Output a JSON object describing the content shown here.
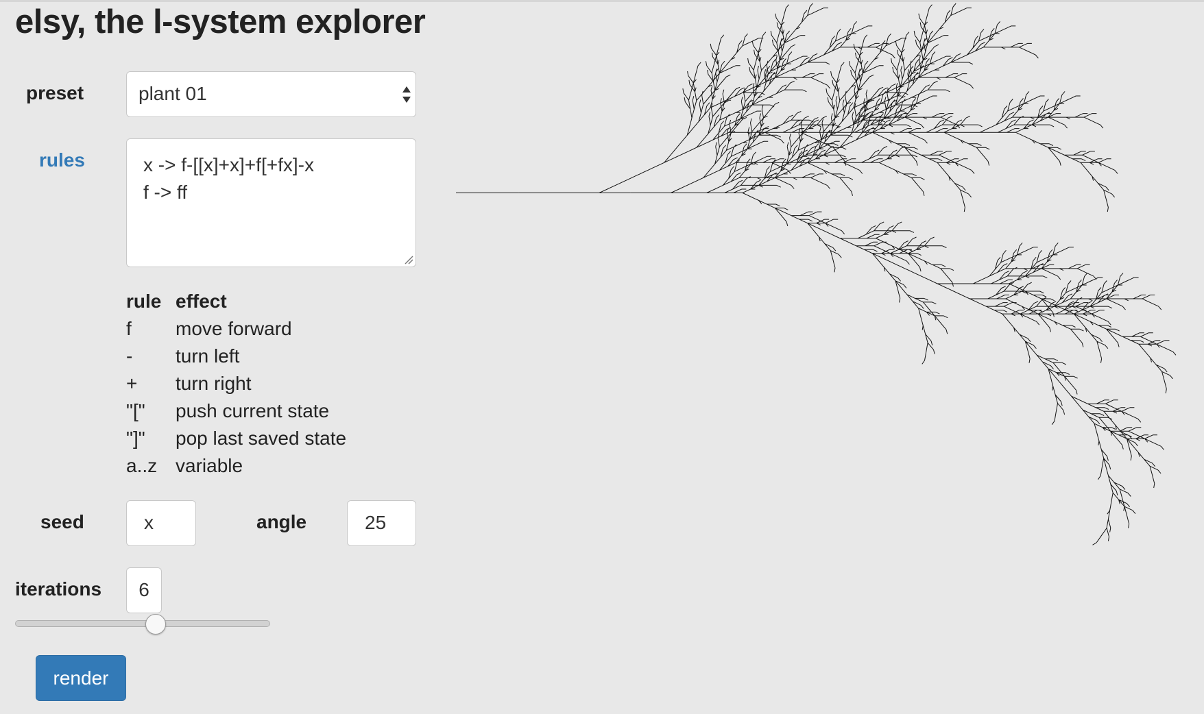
{
  "app": {
    "title": "elsy, the l-system explorer"
  },
  "preset": {
    "label": "preset",
    "value": "plant 01"
  },
  "rules": {
    "label": "rules",
    "lines": [
      "x -> f-[[x]+x]+f[+fx]-x",
      "f -> ff"
    ]
  },
  "reference": {
    "header": {
      "rule": "rule",
      "effect": "effect"
    },
    "rows": [
      {
        "rule": "f",
        "effect": "move forward"
      },
      {
        "rule": "-",
        "effect": "turn left"
      },
      {
        "rule": "+",
        "effect": "turn right"
      },
      {
        "rule": "\"[\"",
        "effect": "push current state"
      },
      {
        "rule": "\"]\"",
        "effect": "pop last saved state"
      },
      {
        "rule": "a..z",
        "effect": "variable"
      }
    ]
  },
  "seed": {
    "label": "seed",
    "value": "x"
  },
  "angle": {
    "label": "angle",
    "value": "25"
  },
  "iterations": {
    "label": "iterations",
    "value": "6",
    "slider_fraction": 0.55
  },
  "render_button": {
    "label": "render"
  },
  "colors": {
    "accent": "#337ab7",
    "background": "#e8e8e8",
    "drawing": "#111111"
  }
}
